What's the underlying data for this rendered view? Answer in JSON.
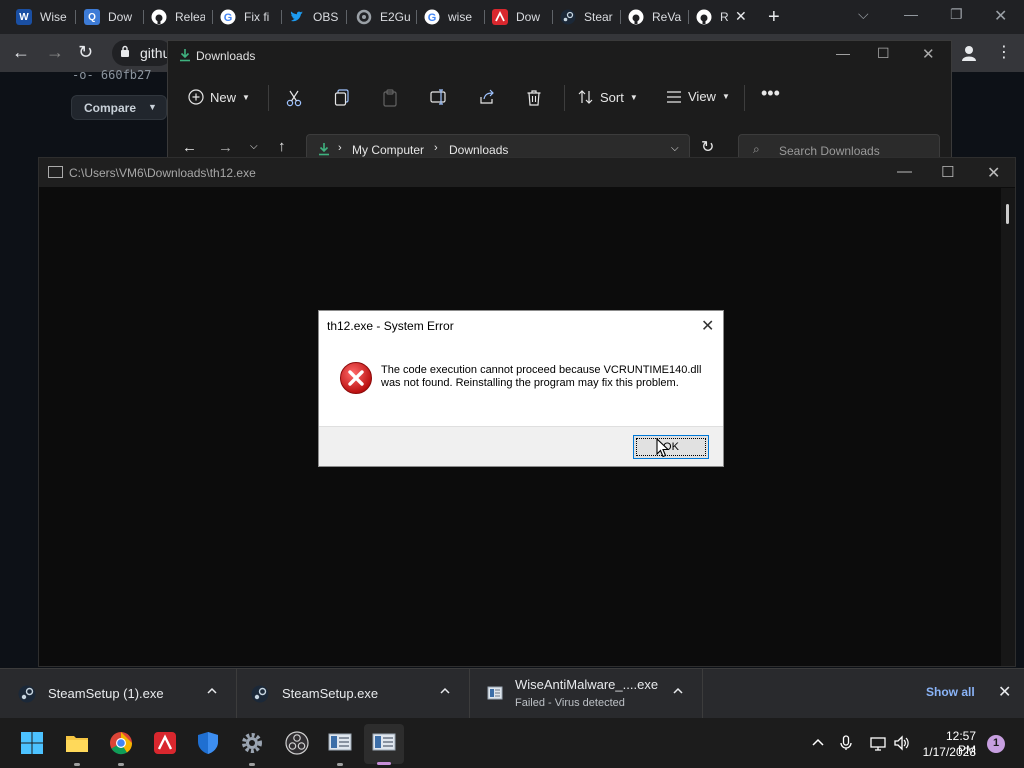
{
  "browser": {
    "tabs": [
      {
        "label": "Wise",
        "icon": "wise-icon",
        "color": "#1a4fa3"
      },
      {
        "label": "Dow",
        "icon": "qbit-icon",
        "color": "#3d7bd6"
      },
      {
        "label": "Relea",
        "icon": "github-icon",
        "color": "#ffffff"
      },
      {
        "label": "Fix fi",
        "icon": "google-icon",
        "color": "#4285f4"
      },
      {
        "label": "OBS",
        "icon": "twitter-icon",
        "color": "#1d9bf0"
      },
      {
        "label": "E2Gu",
        "icon": "gear-site-icon",
        "color": "#9aa0a6"
      },
      {
        "label": "wise",
        "icon": "google-icon",
        "color": "#4285f4"
      },
      {
        "label": "Dow",
        "icon": "avira-icon",
        "color": "#d9272e"
      },
      {
        "label": "Stear",
        "icon": "steam-icon",
        "color": "#4b8bd4"
      },
      {
        "label": "ReVa",
        "icon": "github-icon",
        "color": "#ffffff"
      },
      {
        "label": "R",
        "icon": "github-icon",
        "color": "#ffffff"
      }
    ],
    "omnibox_text": "githu",
    "page": {
      "commit_hash": "-o- 660fb27",
      "compare_label": "Compare"
    }
  },
  "explorer": {
    "title": "Downloads",
    "commands": {
      "new": "New",
      "sort": "Sort",
      "view": "View"
    },
    "breadcrumb": [
      "My Computer",
      "Downloads"
    ],
    "search_placeholder": "Search Downloads"
  },
  "console": {
    "title": "C:\\Users\\VM6\\Downloads\\th12.exe"
  },
  "dialog": {
    "title": "th12.exe - System Error",
    "message": "The code execution cannot proceed because VCRUNTIME140.dll was not found. Reinstalling the program may fix this problem.",
    "ok_label": "OK"
  },
  "downloads": {
    "items": [
      {
        "name": "SteamSetup (1).exe",
        "status": ""
      },
      {
        "name": "SteamSetup.exe",
        "status": ""
      },
      {
        "name": "WiseAntiMalware_....exe",
        "status": "Failed - Virus detected"
      }
    ],
    "show_all": "Show all"
  },
  "taskbar": {
    "time": "12:57 PM",
    "date": "1/17/2023",
    "notifications": "1"
  }
}
